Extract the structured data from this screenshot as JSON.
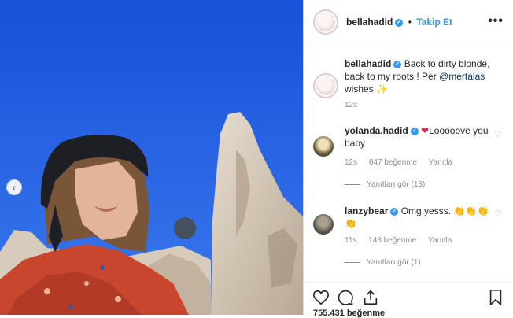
{
  "post": {
    "author": "bellahadid",
    "follow_label": "Takip Et",
    "more_icon": "more-icon"
  },
  "caption": {
    "author": "bellahadid",
    "text_before_mention": "Back to dirty blonde, back to my roots ! Per ",
    "mention": "@mertalas",
    "text_after_mention": " wishes",
    "emoji": "✨",
    "time": "12s"
  },
  "comments": [
    {
      "author": "yolanda.hadid",
      "heart": "❤",
      "text": "Looooove you baby",
      "time": "12s",
      "likes": "647 beğenme",
      "reply": "Yanıtla",
      "view_replies": "Yanıtları gör (13)"
    },
    {
      "author": "lanzybear",
      "text": "Omg yesss.",
      "emoji": "👏👏👏👏",
      "time": "11s",
      "likes": "148 beğenme",
      "reply": "Yanıtla",
      "view_replies": "Yanıtları gör (1)"
    }
  ],
  "likes_total": "755.431 beğenme",
  "colors": {
    "accent": "#3897f0",
    "sky": "#1f5fe0",
    "mention": "#003569"
  }
}
